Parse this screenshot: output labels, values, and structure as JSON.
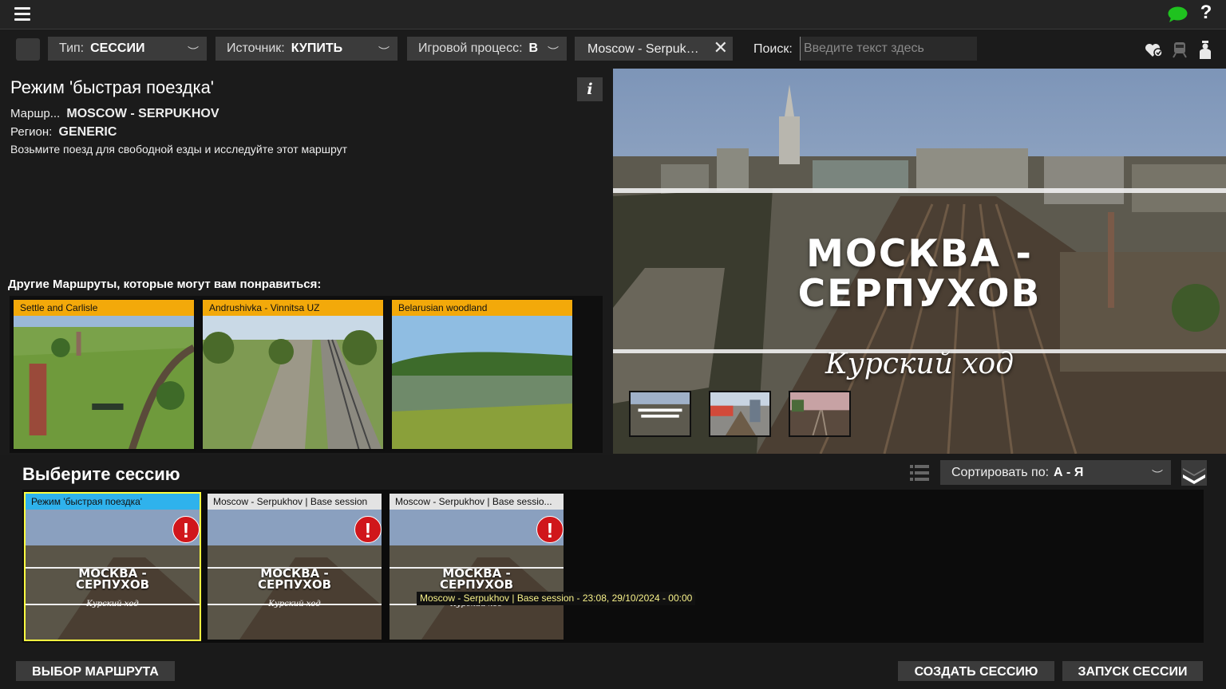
{
  "filters": {
    "type_label": "Тип:",
    "type_value": "СЕССИИ",
    "source_label": "Источник:",
    "source_value": "КУПИТЬ",
    "gameplay_label": "Игровой процесс:",
    "gameplay_value": "В",
    "route_chip": "Moscow - Serpuk…",
    "search_label": "Поиск:",
    "search_placeholder": "Введите текст здесь"
  },
  "info": {
    "mode_title": "Режим 'быстрая поездка'",
    "info_button": "i",
    "route_label": "Маршр...",
    "route_value": "MOSCOW - SERPUKHOV",
    "region_label": "Регион:",
    "region_value": "GENERIC",
    "description": "Возьмите поезд для свободной езды и исследуйте этот маршрут",
    "others_title": "Другие Маршруты, которые могут вам понравиться:",
    "other_routes": [
      "Settle and Carlisle",
      "Andrushivka - Vinnitsa UZ",
      "Belarusian woodland"
    ]
  },
  "hero": {
    "title_line1": "МОСКВА -",
    "title_line2": "СЕРПУХОВ",
    "subtitle": "Курский ход"
  },
  "sessions": {
    "title": "Выберите сессию",
    "sort_label": "Сортировать по:",
    "sort_value": "А - Я",
    "cards": [
      {
        "title": "Режим 'быстрая поездка'",
        "warning": "!"
      },
      {
        "title": "Moscow - Serpukhov | Base session",
        "warning": "!"
      },
      {
        "title": "Moscow - Serpukhov | Base sessio...",
        "warning": "!"
      }
    ],
    "tooltip": "Moscow - Serpukhov | Base session - 23:08, 29/10/2024 - 00:00"
  },
  "buttons": {
    "route_select": "ВЫБОР МАРШРУТА",
    "create_session": "СОЗДАТЬ СЕССИЮ",
    "start_session": "ЗАПУСК СЕССИИ"
  },
  "colors": {
    "accent_orange": "#f3a90a",
    "selected_blue": "#2fb2ec",
    "selected_border": "#ffff40",
    "warning_red": "#d0161b",
    "chat_green": "#1fc21f"
  }
}
